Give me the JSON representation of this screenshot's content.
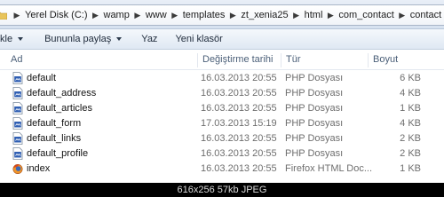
{
  "breadcrumb": [
    "Yerel Disk (C:)",
    "wamp",
    "www",
    "templates",
    "zt_xenia25",
    "html",
    "com_contact",
    "contact"
  ],
  "toolbar": {
    "items": [
      "kle",
      "Bununla paylaş",
      "Yaz",
      "Yeni klasör"
    ]
  },
  "columns": {
    "name": "Ad",
    "date": "Değiştirme tarihi",
    "type": "Tür",
    "size": "Boyut"
  },
  "files": [
    {
      "name": "default",
      "date": "16.03.2013 20:55",
      "type": "PHP Dosyası",
      "size": "6 KB",
      "icon": "php-file-icon"
    },
    {
      "name": "default_address",
      "date": "16.03.2013 20:55",
      "type": "PHP Dosyası",
      "size": "4 KB",
      "icon": "php-file-icon"
    },
    {
      "name": "default_articles",
      "date": "16.03.2013 20:55",
      "type": "PHP Dosyası",
      "size": "1 KB",
      "icon": "php-file-icon"
    },
    {
      "name": "default_form",
      "date": "17.03.2013 15:19",
      "type": "PHP Dosyası",
      "size": "4 KB",
      "icon": "php-file-icon"
    },
    {
      "name": "default_links",
      "date": "16.03.2013 20:55",
      "type": "PHP Dosyası",
      "size": "2 KB",
      "icon": "php-file-icon"
    },
    {
      "name": "default_profile",
      "date": "16.03.2013 20:55",
      "type": "PHP Dosyası",
      "size": "2 KB",
      "icon": "php-file-icon"
    },
    {
      "name": "index",
      "date": "16.03.2013 20:55",
      "type": "Firefox HTML Doc...",
      "size": "1 KB",
      "icon": "firefox-html-icon"
    }
  ],
  "status_caption": "616x256  57kb  JPEG"
}
